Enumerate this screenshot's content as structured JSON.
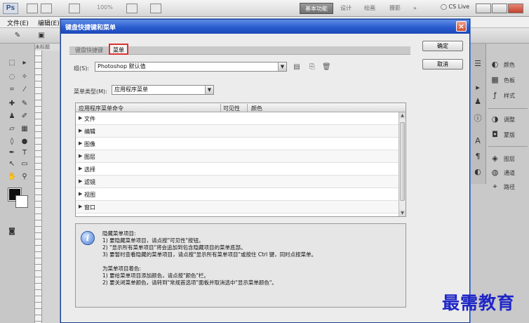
{
  "app": {
    "logo": "Ps",
    "zoom_level": "100%",
    "workspaces": [
      "基本功能",
      "设计",
      "绘画",
      "摄影"
    ],
    "more": "»",
    "cslive": "CS Live"
  },
  "menubar": [
    "文件(E)",
    "编辑(E)"
  ],
  "doc_tab": "未标题",
  "dialog": {
    "title": "键盘快捷键和菜单",
    "close": "×",
    "tabs": [
      "键盘快捷键",
      "菜单"
    ],
    "ok_label": "确定",
    "cancel_label": "取消",
    "set_label": "组(S):",
    "set_value": "Photoshop 默认值",
    "menu_for_label": "菜单类型(M):",
    "menu_for_value": "应用程序菜单",
    "columns": [
      "应用程序菜单命令",
      "可见性",
      "颜色"
    ],
    "rows": [
      "文件",
      "编辑",
      "图像",
      "图层",
      "选择",
      "滤镜",
      "视图",
      "窗口"
    ],
    "info_lines": [
      "隐藏菜单项目:",
      "1) 要隐藏菜单项目，请点按\"可见性\"按钮。",
      "2) \"显示所有菜单项目\"将会追加到包含隐藏项目的菜单底部。",
      "3) 要暂时查看隐藏的菜单项目，请点按\"显示所有菜单项目\"或按住 Ctrl 键，同时点按菜单。",
      "为菜单项目着色:",
      "1) 要给菜单项目添加颜色，请点按\"颜色\"栏。",
      "2) 要关闭菜单颜色，请转到\"常规首选项\"面板并取消选中\"显示菜单颜色\"。"
    ]
  },
  "right_panels": [
    "颜色",
    "色板",
    "样式",
    "调整",
    "蒙版",
    "图层",
    "通道",
    "路径"
  ],
  "watermark": "最需教育",
  "colors": {
    "title_bar": "#2a5ccf",
    "tab_highlight": "#dd3333",
    "watermark": "#1f27c7"
  }
}
